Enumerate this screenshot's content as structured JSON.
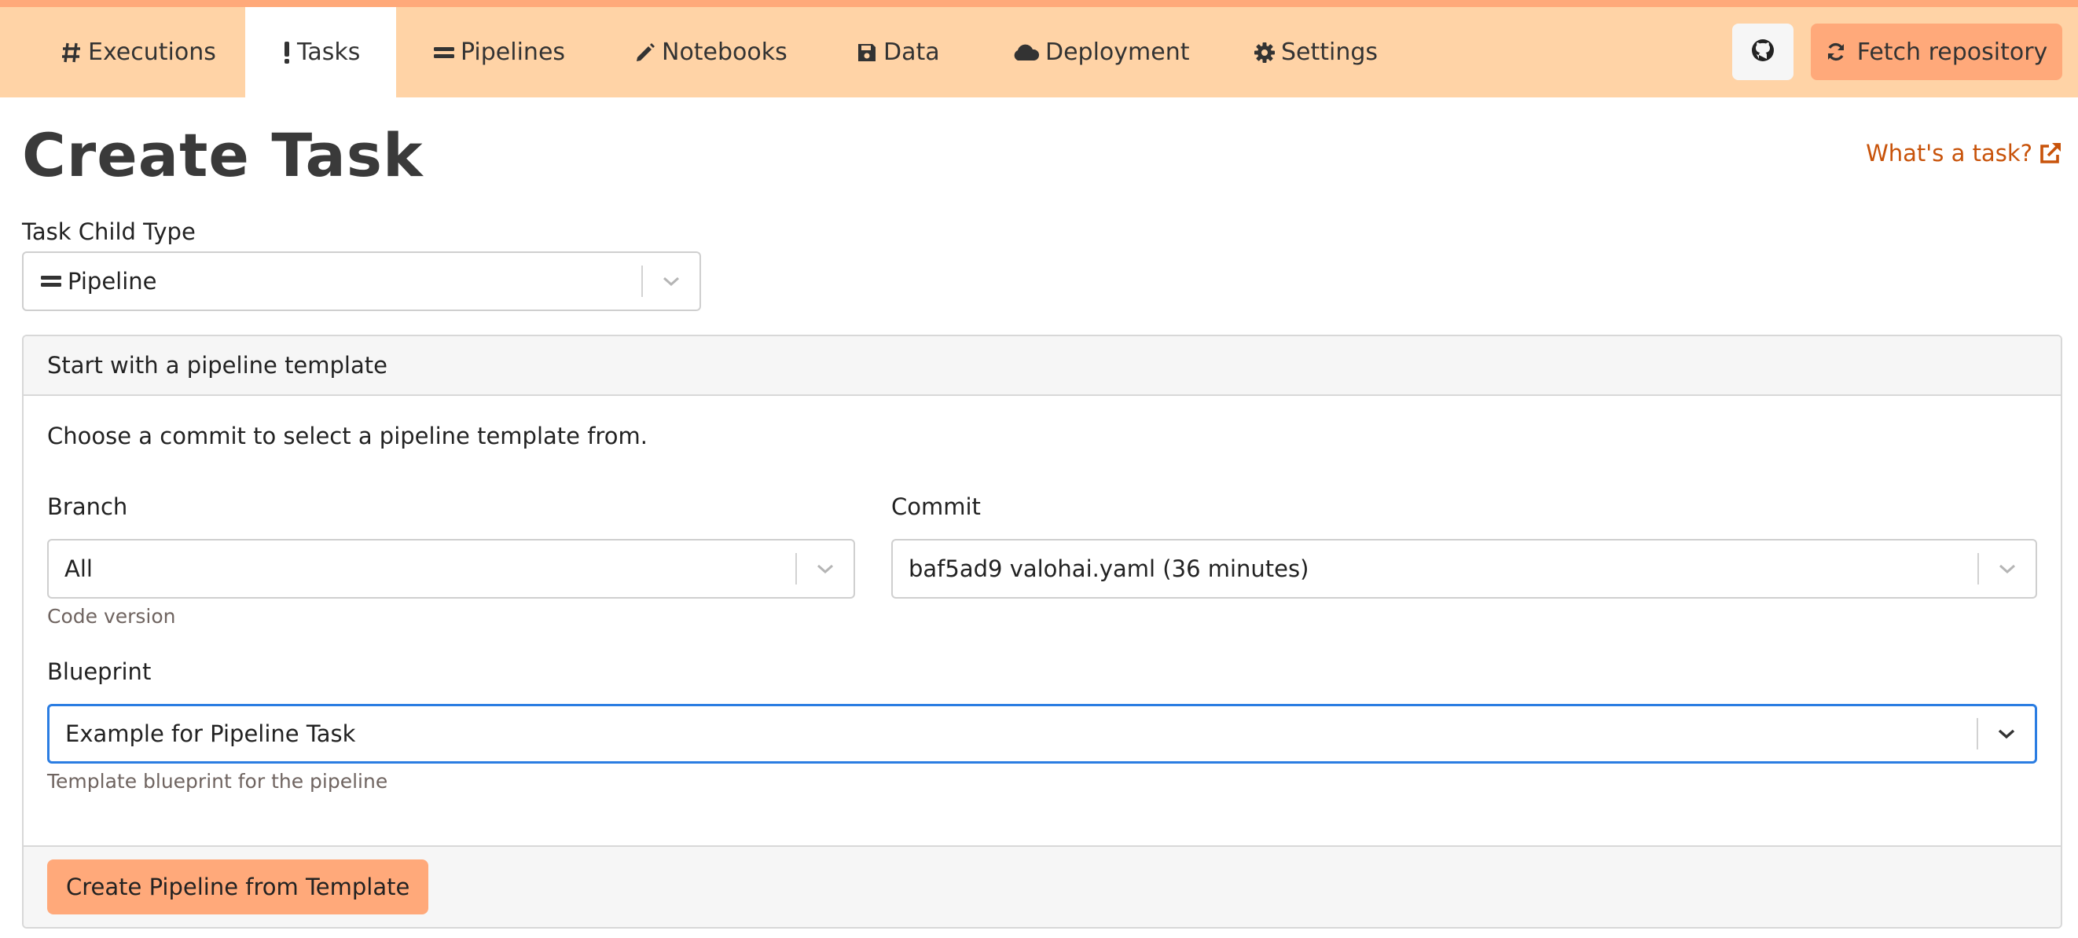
{
  "nav": {
    "tabs": [
      {
        "label": "Executions",
        "icon": "hash-icon"
      },
      {
        "label": "Tasks",
        "icon": "exclamation-icon",
        "active": true
      },
      {
        "label": "Pipelines",
        "icon": "equals-icon"
      },
      {
        "label": "Notebooks",
        "icon": "pencil-icon"
      },
      {
        "label": "Data",
        "icon": "floppy-disk-icon"
      },
      {
        "label": "Deployment",
        "icon": "cloud-icon"
      },
      {
        "label": "Settings",
        "icon": "gear-icon"
      }
    ],
    "github_icon": "github-icon",
    "fetch_label": "Fetch repository",
    "fetch_icon": "refresh-icon"
  },
  "page": {
    "title": "Create Task",
    "help_link": "What's a task?",
    "help_icon": "external-link-icon"
  },
  "task_child_type": {
    "label": "Task Child Type",
    "value": "Pipeline",
    "icon": "equals-icon"
  },
  "card": {
    "header": "Start with a pipeline template",
    "description": "Choose a commit to select a pipeline template from.",
    "branch": {
      "label": "Branch",
      "value": "All",
      "hint": "Code version"
    },
    "commit": {
      "label": "Commit",
      "value": "baf5ad9 valohai.yaml (36 minutes)"
    },
    "blueprint": {
      "label": "Blueprint",
      "value": "Example for Pipeline Task",
      "hint": "Template blueprint for the pipeline"
    },
    "submit_label": "Create Pipeline from Template"
  },
  "colors": {
    "nav_bg": "#ffd3a6",
    "accent": "#ffa97a",
    "link": "#c8530a",
    "focus": "#2b7de2"
  }
}
